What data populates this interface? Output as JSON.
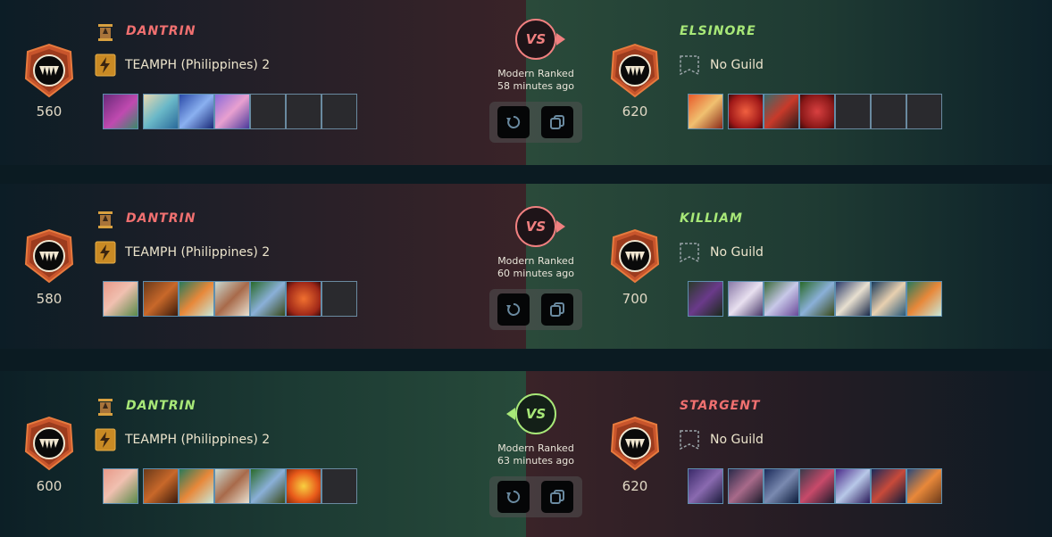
{
  "battles": [
    {
      "vs_label": "VS",
      "mode": "Modern Ranked",
      "time": "58 minutes ago",
      "player": {
        "name": "DANTRIN",
        "rating": "560",
        "guild": "TEAMPH (Philippines) 2"
      },
      "opponent": {
        "name": "ELSINORE",
        "rating": "620",
        "guild": "No Guild"
      },
      "left_result": "loss"
    },
    {
      "vs_label": "VS",
      "mode": "Modern Ranked",
      "time": "60 minutes ago",
      "player": {
        "name": "DANTRIN",
        "rating": "580",
        "guild": "TEAMPH (Philippines) 2"
      },
      "opponent": {
        "name": "KILLIAM",
        "rating": "700",
        "guild": "No Guild"
      },
      "left_result": "loss"
    },
    {
      "vs_label": "VS",
      "mode": "Modern Ranked",
      "time": "63 minutes ago",
      "player": {
        "name": "DANTRIN",
        "rating": "600",
        "guild": "TEAMPH (Philippines) 2"
      },
      "opponent": {
        "name": "STARGENT",
        "rating": "620",
        "guild": "No Guild"
      },
      "left_result": "win"
    }
  ],
  "colors": {
    "loss_name": "#f07070",
    "win_name": "#a8e878",
    "card_border": "#5e8eae"
  },
  "icons": {
    "rank": "league-banner-icon",
    "guild_player": "lightning-guild-icon",
    "guild_none": "empty-guild-icon",
    "replay": "replay-icon",
    "copy": "copy-icon"
  }
}
